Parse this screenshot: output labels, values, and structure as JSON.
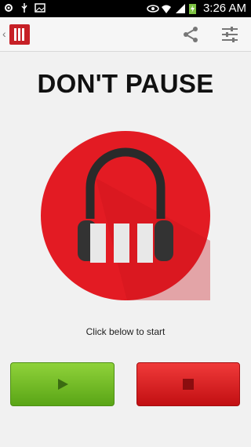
{
  "status_bar": {
    "time": "3:26 AM",
    "left_icons": [
      "settings-gear-icon",
      "usb-icon",
      "image-icon"
    ],
    "right_icons": [
      "eye-icon",
      "wifi-icon",
      "signal-icon",
      "battery-charging-icon"
    ]
  },
  "action_bar": {
    "app_icon": "pause-logo-icon",
    "actions": [
      "share-icon",
      "equalizer-settings-icon"
    ]
  },
  "main": {
    "title": "DON'T PAUSE",
    "hint": "Click below to start"
  },
  "controls": {
    "play_icon": "play-icon",
    "stop_icon": "stop-icon"
  },
  "colors": {
    "brand_red": "#e31b23",
    "play_green": "#6fb923",
    "stop_red": "#d61719"
  }
}
